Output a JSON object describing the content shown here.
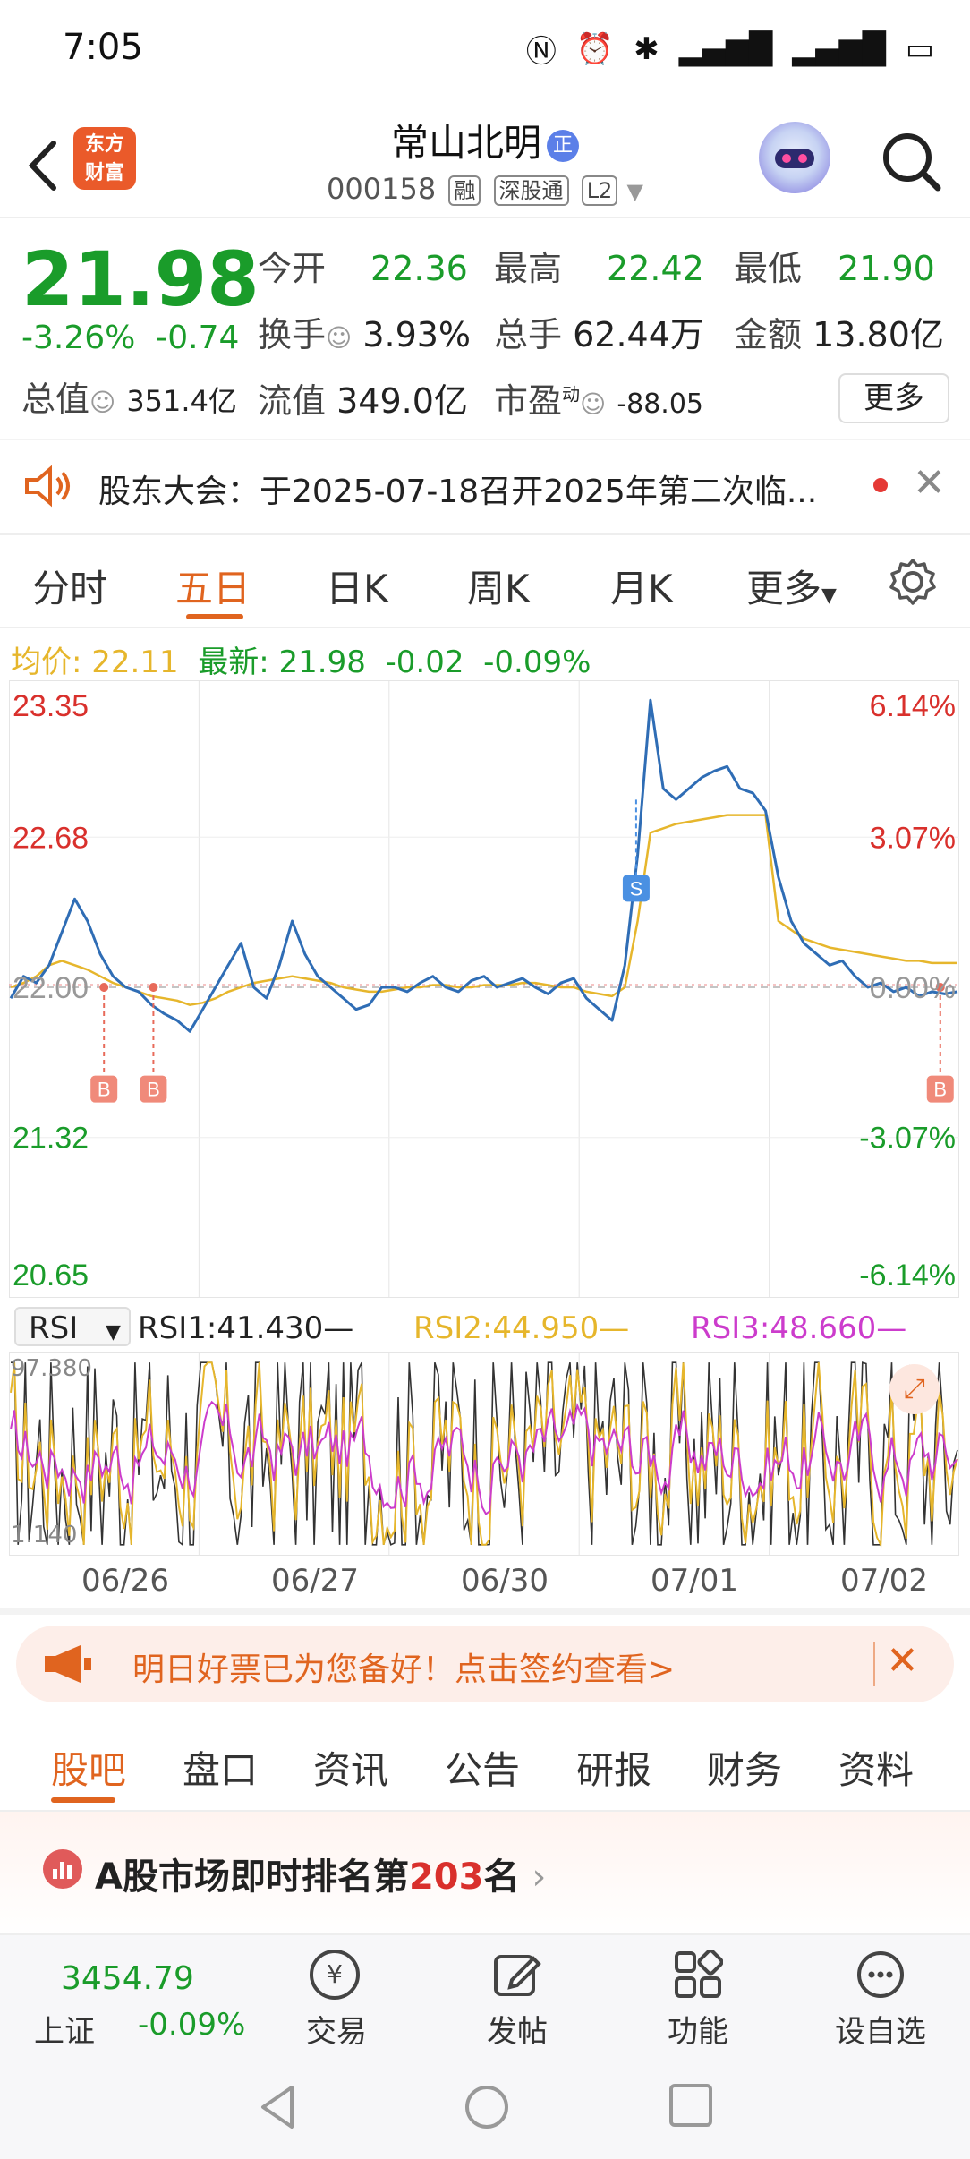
{
  "status": {
    "time": "7:05"
  },
  "header": {
    "logo_line1": "东方",
    "logo_line2": "财富",
    "stock_name": "常山北明",
    "badge": "正",
    "code": "000158",
    "tags": [
      "融",
      "深股通",
      "L2"
    ]
  },
  "quote": {
    "price": "21.98",
    "change_pct": "-3.26%",
    "change": "-0.74",
    "open_label": "今开",
    "open": "22.36",
    "high_label": "最高",
    "high": "22.42",
    "low_label": "最低",
    "low": "21.90",
    "turnover_label": "换手",
    "turnover": "3.93%",
    "volume_label": "总手",
    "volume": "62.44万",
    "amount_label": "金额",
    "amount": "13.80亿",
    "mktcap_label": "总值",
    "mktcap": "351.4亿",
    "float_label": "流值",
    "float": "349.0亿",
    "pe_label": "市盈",
    "pe_sup": "动",
    "pe": "-88.05",
    "more": "更多"
  },
  "notice": {
    "text": "股东大会：于2025-07-18召开2025年第二次临..."
  },
  "chart_tabs": [
    "分时",
    "五日",
    "日K",
    "周K",
    "月K",
    "更多"
  ],
  "avg_bar": {
    "avg_label": "均价:",
    "avg_value": "22.11",
    "latest_label": "最新:",
    "latest_value": "21.98",
    "latest_change": "-0.02",
    "latest_pct": "-0.09%"
  },
  "chart_data": {
    "type": "line",
    "y_left_ticks": [
      "23.35",
      "22.68",
      "22.00",
      "21.32",
      "20.65"
    ],
    "y_right_ticks": [
      "6.14%",
      "3.07%",
      "0.00%",
      "-3.07%",
      "-6.14%"
    ],
    "x_days": [
      "06/26",
      "06/27",
      "06/30",
      "07/01",
      "07/02"
    ],
    "ylim": [
      20.65,
      23.35
    ],
    "prev_close": 22.0,
    "price_series": [
      21.95,
      22.05,
      22.02,
      22.1,
      22.25,
      22.4,
      22.3,
      22.15,
      22.05,
      22.0,
      21.98,
      21.92,
      21.88,
      21.85,
      21.8,
      21.9,
      22.0,
      22.1,
      22.2,
      22.0,
      21.95,
      22.1,
      22.3,
      22.15,
      22.05,
      22.0,
      21.95,
      21.9,
      21.92,
      22.0,
      22.0,
      21.98,
      22.02,
      22.05,
      22.0,
      21.98,
      22.03,
      22.05,
      22.0,
      22.02,
      22.04,
      22.0,
      21.97,
      22.02,
      22.04,
      21.95,
      21.9,
      21.85,
      22.1,
      22.6,
      23.3,
      22.9,
      22.85,
      22.9,
      22.95,
      22.98,
      23.0,
      22.9,
      22.88,
      22.8,
      22.5,
      22.3,
      22.2,
      22.15,
      22.1,
      22.12,
      22.05,
      22.0,
      22.02,
      21.98,
      22.0,
      21.96,
      21.98,
      21.97,
      21.98
    ],
    "avg_series": [
      22.0,
      22.02,
      22.05,
      22.1,
      22.12,
      22.1,
      22.08,
      22.05,
      22.02,
      22.0,
      21.98,
      21.96,
      21.95,
      21.94,
      21.92,
      21.93,
      21.95,
      21.98,
      22.0,
      22.02,
      22.03,
      22.04,
      22.05,
      22.04,
      22.03,
      22.02,
      22.0,
      21.99,
      21.98,
      21.98,
      21.99,
      22.0,
      22.0,
      22.01,
      22.01,
      22.0,
      22.0,
      22.01,
      22.01,
      22.01,
      22.02,
      22.02,
      22.01,
      22.0,
      22.0,
      21.98,
      21.97,
      21.96,
      22.0,
      22.3,
      22.7,
      22.72,
      22.74,
      22.75,
      22.76,
      22.77,
      22.78,
      22.78,
      22.78,
      22.78,
      22.3,
      22.26,
      22.22,
      22.2,
      22.18,
      22.17,
      22.16,
      22.15,
      22.14,
      22.13,
      22.12,
      22.12,
      22.11,
      22.11,
      22.11
    ],
    "markers": [
      {
        "type": "B",
        "day_pos": 0.5
      },
      {
        "type": "B",
        "day_pos": 0.76
      },
      {
        "type": "S",
        "day_pos": 3.3
      },
      {
        "type": "B",
        "day_pos": 4.9
      }
    ],
    "grid": true
  },
  "rsi": {
    "select": "RSI",
    "rsi1_label": "RSI1:41.430—",
    "rsi2_label": "RSI2:44.950—",
    "rsi3_label": "RSI3:48.660—",
    "ymax": "97.380",
    "ymin": "1.140",
    "colors": {
      "rsi1": "#333333",
      "rsi2": "#e6b62c",
      "rsi3": "#cc3ccc"
    }
  },
  "promo": {
    "text": "明日好票已为您备好！点击签约查看>"
  },
  "sub_tabs": [
    "股吧",
    "盘口",
    "资讯",
    "公告",
    "研报",
    "财务",
    "资料"
  ],
  "rank": {
    "prefix": "A股市场即时排名第",
    "num": "203",
    "suffix": "名"
  },
  "bottom": {
    "index_value": "3454.79",
    "index_name": "上证",
    "index_change": "-0.09%",
    "items": [
      "交易",
      "发帖",
      "功能",
      "设自选"
    ]
  },
  "colors": {
    "accent": "#e0641f",
    "up": "#d9302c",
    "down": "#1a9c2a",
    "line": "#2f6db5",
    "avg": "#e6b62c"
  }
}
